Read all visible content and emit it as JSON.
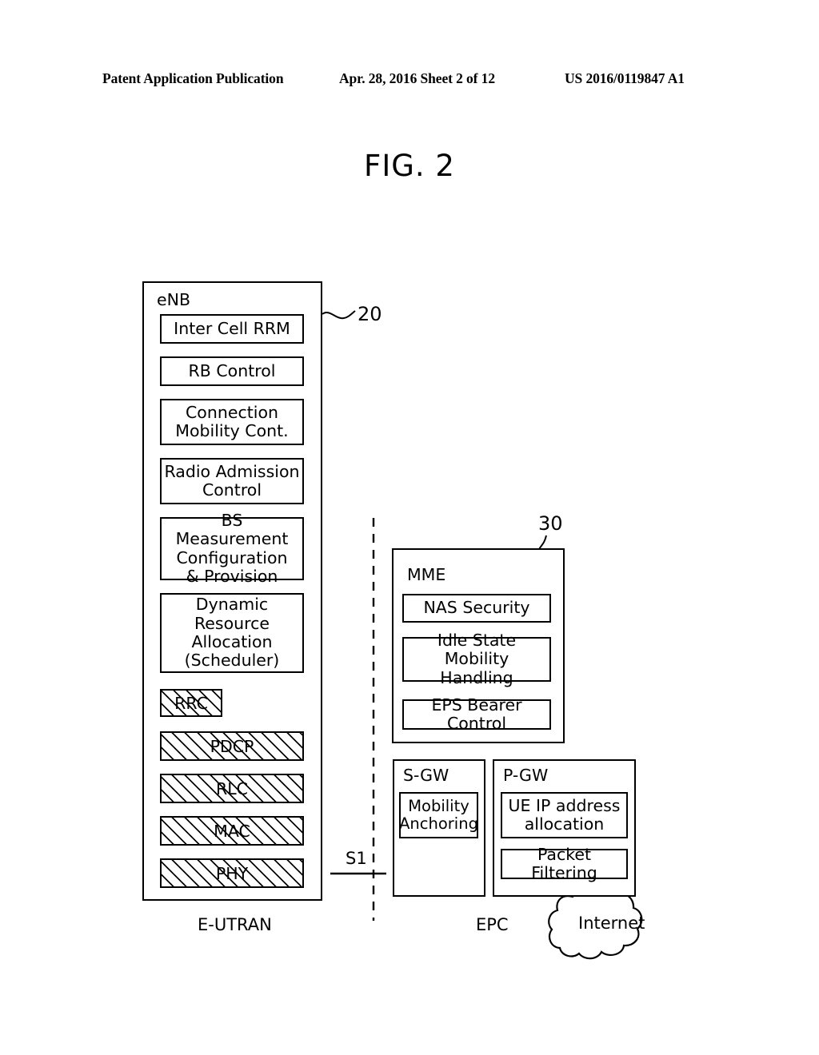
{
  "header": {
    "publication": "Patent Application Publication",
    "date_sheet": "Apr. 28, 2016  Sheet 2 of 12",
    "patent_number": "US 2016/0119847 A1"
  },
  "figure": {
    "title": "FIG. 2"
  },
  "diagram": {
    "enb": {
      "label": "eNB",
      "ref": "20",
      "functions": [
        "Inter Cell RRM",
        "RB Control",
        "Connection\nMobility Cont.",
        "Radio Admission\nControl",
        "BS Measurement\nConfiguration\n& Provision",
        "Dynamic Resource\nAllocation\n(Scheduler)"
      ],
      "layers": [
        "RRC",
        "PDCP",
        "RLC",
        "MAC",
        "PHY"
      ]
    },
    "mme": {
      "label": "MME",
      "ref": "30",
      "functions": [
        "NAS Security",
        "Idle State Mobility\nHandling",
        "EPS Bearer Control"
      ]
    },
    "sgw": {
      "label": "S-GW",
      "functions": [
        "Mobility\nAnchoring"
      ]
    },
    "pgw": {
      "label": "P-GW",
      "functions": [
        "UE IP address\nallocation",
        "Packet Filtering"
      ]
    },
    "interface": {
      "label": "S1"
    },
    "cloud": {
      "label": "Internet"
    },
    "captions": {
      "left": "E-UTRAN",
      "right": "EPC"
    }
  }
}
